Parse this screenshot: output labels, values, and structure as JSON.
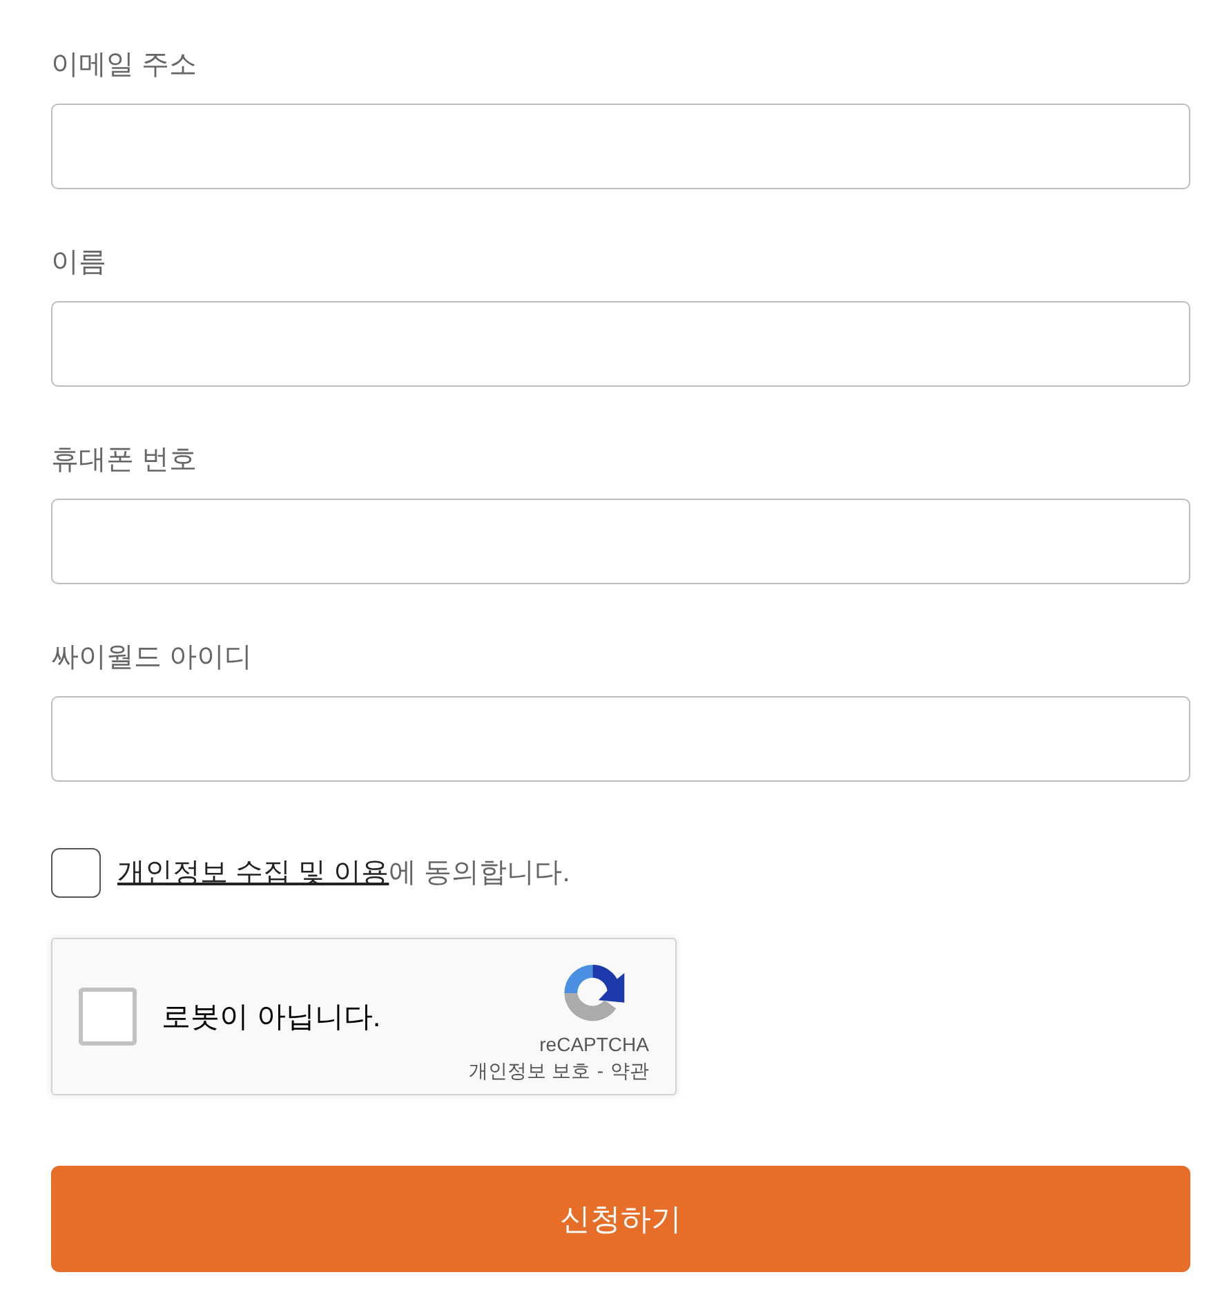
{
  "fields": [
    {
      "label": "이메일 주소"
    },
    {
      "label": "이름"
    },
    {
      "label": "휴대폰 번호"
    },
    {
      "label": "싸이월드 아이디"
    }
  ],
  "consent": {
    "checked": false,
    "link": "개인정보 수집 및 이용",
    "text": "에 동의합니다."
  },
  "recaptcha": {
    "checked": false,
    "label": "로봇이 아닙니다.",
    "brand": "reCAPTCHA",
    "privacy": "개인정보 보호",
    "separator": "-",
    "terms": "약관"
  },
  "submit": {
    "label": "신청하기"
  }
}
